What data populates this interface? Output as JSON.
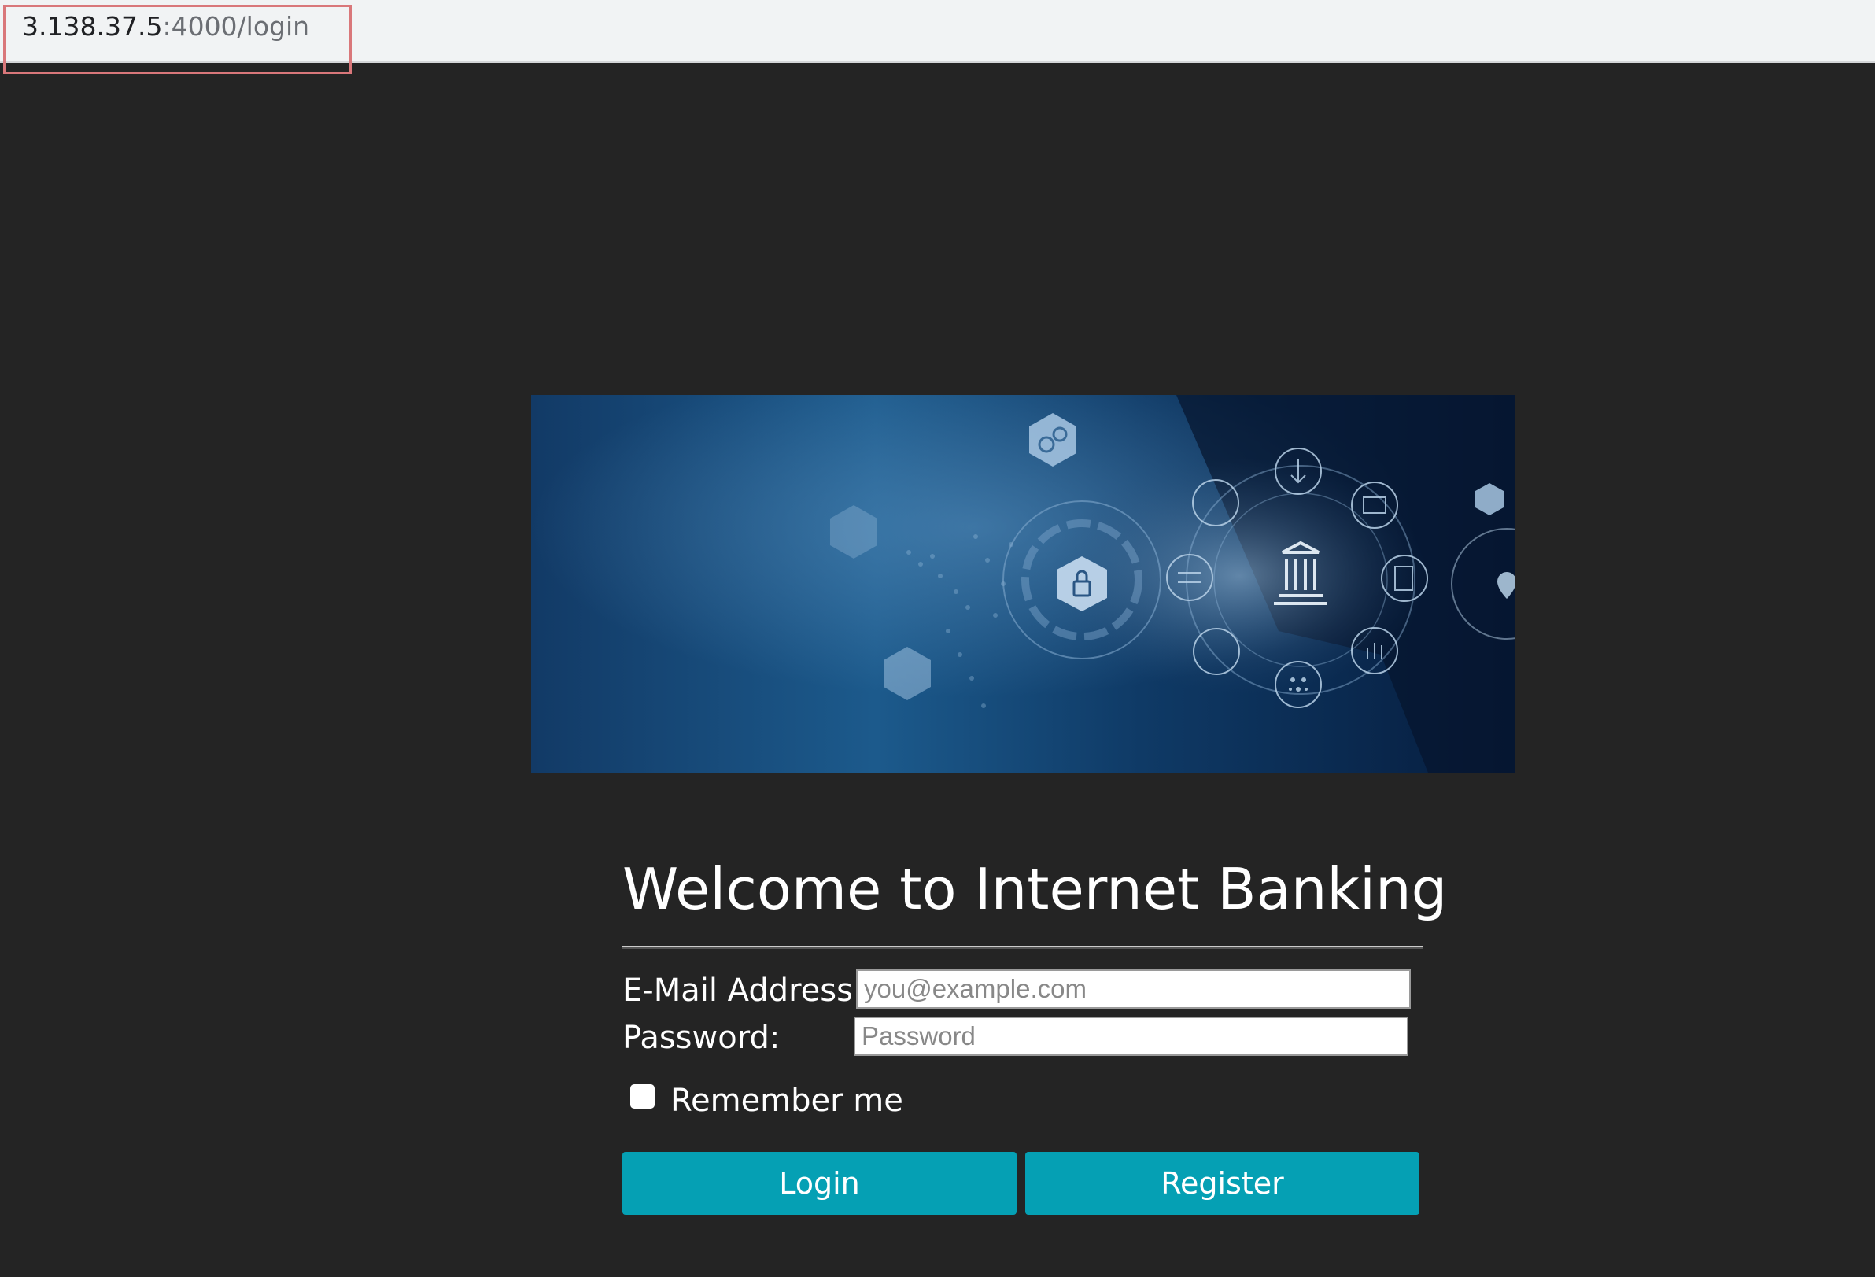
{
  "browser": {
    "url_host": "3.138.37.5",
    "url_path": ":4000/login"
  },
  "hero": {
    "icons": [
      "gears-icon",
      "arrow-down-icon",
      "barcode-icon",
      "dollar-card-icon",
      "transfer-arrows-icon",
      "bank-icon",
      "document-dollar-icon",
      "padlock-icon",
      "cloud-icon",
      "wifi-icon",
      "hand-coin-icon",
      "dots-icon",
      "bar-chart-icon",
      "location-pin-icon"
    ]
  },
  "login": {
    "title": "Welcome to Internet Banking",
    "email_label": "E-Mail Address:",
    "email_placeholder": "you@example.com",
    "password_label": "Password:",
    "password_placeholder": "Password",
    "remember_label": "Remember me",
    "login_button": "Login",
    "register_button": "Register"
  },
  "colors": {
    "background": "#242424",
    "button": "#05a0b4"
  }
}
